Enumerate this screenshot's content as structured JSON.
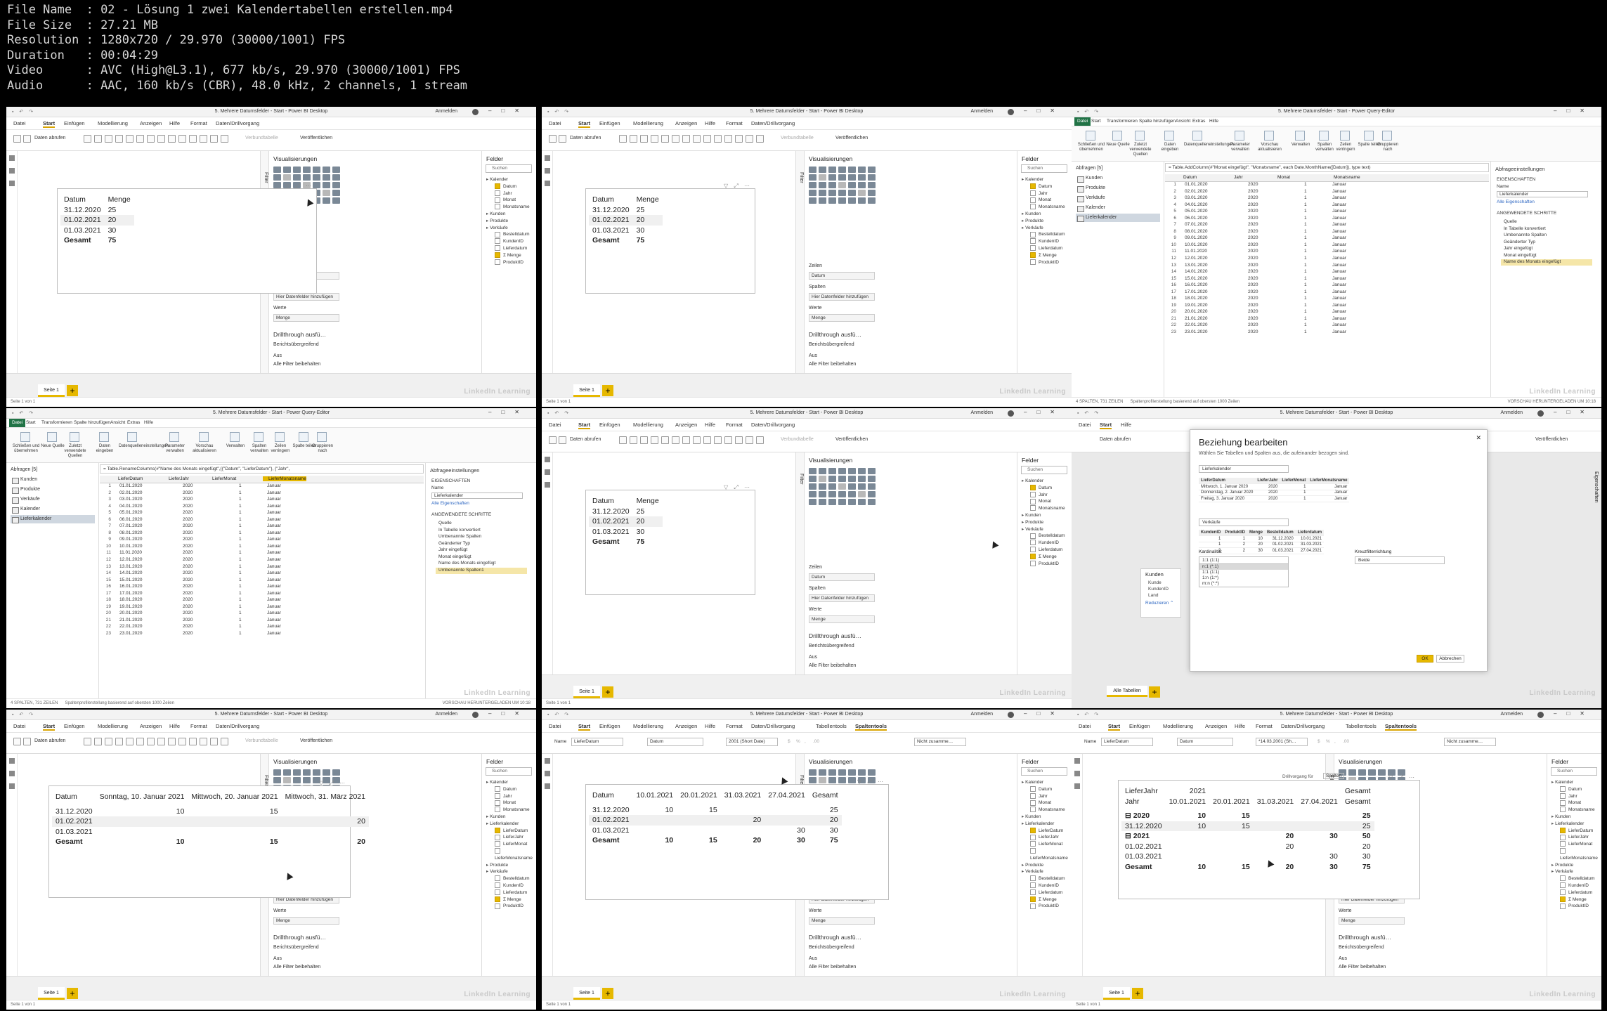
{
  "meta": {
    "file_name": "02 - Lösung 1 zwei Kalendertabellen erstellen.mp4",
    "file_size": "27.21 MB",
    "resolution": "1280x720 / 29.970 (30000/1001) FPS",
    "duration": "00:04:29",
    "video": "AVC (High@L3.1), 677 kb/s, 29.970 (30000/1001) FPS",
    "audio": "AAC, 160 kb/s (CBR), 48.0 kHz, 2 channels, 1 stream",
    "labels": {
      "file_name": "File Name  : ",
      "file_size": "File Size  : ",
      "resolution": "Resolution : ",
      "duration": "Duration   : ",
      "video": "Video      : ",
      "audio": "Audio      : "
    }
  },
  "pbi": {
    "title": "5. Mehrere Datumsfelder - Start - Power BI Desktop",
    "signin": "Anmelden",
    "menu": [
      "Datei",
      "Start",
      "Einfügen",
      "Modellierung",
      "Anzeigen",
      "Hilfe",
      "Format",
      "Daten/Drilldrilldrillvorgang"
    ],
    "menu_fix": [
      "Datei",
      "Start",
      "Einfügen",
      "Modellierung",
      "Anzeigen",
      "Hilfe",
      "Format",
      "Daten/Drillvorgang"
    ],
    "ribbon": {
      "get_data": "Daten abrufen",
      "refresh": "Veröffentlichen",
      "recent": "Verbundtabelle"
    },
    "filter": "Filter",
    "visualizations": "Visualisierungen",
    "fields": "Felder",
    "search": "Suchen",
    "rows_label": "Zeilen",
    "cols_label": "Spalten",
    "values_label": "Werte",
    "rows_val": "Datum",
    "rows_val2": "LieferDatum",
    "cols_placeholder": "Hier Datenfelder hinzufügen",
    "values_val": "Menge",
    "drillthrough": "Drillthrough ausfü…",
    "crossreport": "Berichtsübergreifend",
    "off": "Aus",
    "keepall": "Alle Filter beibehalten",
    "page_tab": "Seite 1",
    "page_status": "Seite 1 von 1",
    "watermark": "LinkedIn Learning",
    "fields_list_a": [
      {
        "t": "Kalender",
        "k": "grp"
      },
      {
        "t": "Datum",
        "k": "ck"
      },
      {
        "t": "Jahr",
        "k": "c"
      },
      {
        "t": "Monat",
        "k": "c"
      },
      {
        "t": "Monatsname",
        "k": "c"
      },
      {
        "t": "Kunden",
        "k": "grp"
      },
      {
        "t": "Produkte",
        "k": "grp"
      },
      {
        "t": "Verkäufe",
        "k": "grp"
      },
      {
        "t": "Bestelldatum",
        "k": "c"
      },
      {
        "t": "KundenID",
        "k": "c"
      },
      {
        "t": "Lieferdatum",
        "k": "c"
      },
      {
        "t": "Σ Menge",
        "k": "ck"
      },
      {
        "t": "ProduktID",
        "k": "c"
      }
    ],
    "fields_list_b": [
      {
        "t": "Kalender",
        "k": "grp"
      },
      {
        "t": "Datum",
        "k": "c"
      },
      {
        "t": "Jahr",
        "k": "c"
      },
      {
        "t": "Monat",
        "k": "c"
      },
      {
        "t": "Monatsname",
        "k": "c"
      },
      {
        "t": "Kunden",
        "k": "grp"
      },
      {
        "t": "Lieferkalender",
        "k": "grp"
      },
      {
        "t": "LieferDatum",
        "k": "ck"
      },
      {
        "t": "LieferJahr",
        "k": "c"
      },
      {
        "t": "LieferMonat",
        "k": "c"
      },
      {
        "t": "LieferMonatsname",
        "k": "c"
      },
      {
        "t": "Produkte",
        "k": "grp"
      },
      {
        "t": "Verkäufe",
        "k": "grp"
      },
      {
        "t": "Bestelldatum",
        "k": "c"
      },
      {
        "t": "KundenID",
        "k": "c"
      },
      {
        "t": "Lieferdatum",
        "k": "c"
      },
      {
        "t": "Σ Menge",
        "k": "ck"
      },
      {
        "t": "ProduktID",
        "k": "c"
      }
    ]
  },
  "matrix_a": {
    "h1": "Datum",
    "h2": "Menge",
    "rows": [
      [
        "31.12.2020",
        "25"
      ],
      [
        "01.02.2021",
        "20"
      ],
      [
        "01.03.2021",
        "30"
      ]
    ],
    "total": [
      "Gesamt",
      "75"
    ]
  },
  "matrix_c": {
    "headers": [
      "Datum",
      "Sonntag, 10. Januar 2021",
      "Mittwoch, 20. Januar 2021",
      "Mittwoch, 31. März 2021"
    ],
    "rows": [
      [
        "31.12.2020",
        "10",
        "15",
        ""
      ],
      [
        "01.02.2021",
        "",
        "",
        "20"
      ],
      [
        "01.03.2021",
        "",
        "",
        ""
      ]
    ],
    "total": [
      "Gesamt",
      "10",
      "15",
      "20"
    ]
  },
  "matrix_d": {
    "headers": [
      "Datum",
      "10.01.2021",
      "20.01.2021",
      "31.03.2021",
      "27.04.2021",
      "Gesamt"
    ],
    "rows": [
      [
        "31.12.2020",
        "10",
        "15",
        "",
        "",
        "25"
      ],
      [
        "01.02.2021",
        "",
        "",
        "20",
        "",
        "20"
      ],
      [
        "01.03.2021",
        "",
        "",
        "",
        "30",
        "30"
      ]
    ],
    "total": [
      "Gesamt",
      "10",
      "15",
      "20",
      "30",
      "75"
    ]
  },
  "matrix_e": {
    "h_row1": [
      "LieferJahr",
      "2021",
      "",
      "",
      "",
      "Gesamt"
    ],
    "h_row2": [
      "Jahr",
      "10.01.2021",
      "20.01.2021",
      "31.03.2021",
      "27.04.2021",
      "Gesamt"
    ],
    "rows": [
      [
        "⊟ 2020",
        "10",
        "15",
        "",
        "",
        "25"
      ],
      [
        "31.12.2020",
        "10",
        "15",
        "",
        "",
        "25"
      ],
      [
        "⊟ 2021",
        "",
        "",
        "20",
        "30",
        "50"
      ],
      [
        "01.02.2021",
        "",
        "",
        "20",
        "",
        "20"
      ],
      [
        "01.03.2021",
        "",
        "",
        "",
        "30",
        "30"
      ]
    ],
    "total": [
      "Gesamt",
      "10",
      "15",
      "20",
      "30",
      "75"
    ]
  },
  "column_tools": {
    "name_label": "Name",
    "name_val": "LieferDatum",
    "type_val": "Datum",
    "format_d": "2001 (Short Date)",
    "format_e": "*14.03.2001 (Sh…",
    "summarize": "Nicht zusamme…",
    "tab_table": "Tabellentools",
    "tab_column": "Spaltentools",
    "drillvorgang": "Drillvorgang für",
    "spalten": "Spalten"
  },
  "pq": {
    "title": "5. Mehrere Datumsfelder - Start - Power Query-Editor",
    "tabs": [
      "Datei",
      "Start",
      "Transformieren",
      "Spalte hinzufügen",
      "Ansicht",
      "Extras",
      "Hilfe"
    ],
    "queries_hdr": "Abfragen [5]",
    "queries": [
      "Kunden",
      "Produkte",
      "Verkäufe",
      "Kalender",
      "Lieferkalender"
    ],
    "formula_1": "= Table.AddColumn(#\"Monat eingefügt\", \"Monatsname\", each Date.MonthName([Datum]), type text)",
    "formula_2": "= Table.RenameColumns(#\"Name des Monats eingefügt\",{{\"Datum\", \"LieferDatum\"}, {\"Jahr\",",
    "cols_1": [
      "Datum",
      "Jahr",
      "Monat",
      "Monatsname"
    ],
    "cols_2": [
      "LieferDatum",
      "LieferJahr",
      "LieferMonat",
      "LieferMonatsname"
    ],
    "dates": [
      "01.01.2020",
      "02.01.2020",
      "03.01.2020",
      "04.01.2020",
      "05.01.2020",
      "06.01.2020",
      "07.01.2020",
      "08.01.2020",
      "09.01.2020",
      "10.01.2020",
      "11.01.2020",
      "12.01.2020",
      "13.01.2020",
      "14.01.2020",
      "15.01.2020",
      "16.01.2020",
      "17.01.2020",
      "18.01.2020",
      "19.01.2020",
      "20.01.2020",
      "21.01.2020",
      "22.01.2020",
      "23.01.2020"
    ],
    "year": "2020",
    "month": "1",
    "month_name": "Januar",
    "settings_hdr": "Abfrageeinstellungen",
    "props": "EIGENSCHAFTEN",
    "name_lbl": "Name",
    "name_val": "Lieferkalender",
    "allprops": "Alle Eigenschaften",
    "steps_hdr": "ANGEWENDETE SCHRITTE",
    "steps_1": [
      "Quelle",
      "In Tabelle konvertiert",
      "Umbenannte Spalten",
      "Geänderter Typ",
      "Jahr eingefügt",
      "Monat eingefügt",
      "Name des Monats eingefügt"
    ],
    "steps_2": [
      "Quelle",
      "In Tabelle konvertiert",
      "Umbenannte Spalten",
      "Geänderter Typ",
      "Jahr eingefügt",
      "Monat eingefügt",
      "Name des Monats eingefügt",
      "Umbenannte Spalten1"
    ],
    "status": "4 SPALTEN, 731 ZEILEN",
    "status2": "Spaltenprofilerstellung basierend auf obersten 1000 Zeilen",
    "preview": "VORSCHAU HERUNTERGELADEN UM 10:18",
    "ribbon_labels": [
      "Schließen und übernehmen",
      "Neue Quelle",
      "Zuletzt verwendete Quellen",
      "Daten eingeben",
      "Datenquelleneinstellungen",
      "Parameter verwalten",
      "Vorschau aktualisieren",
      "Verwalten",
      "Spalten verwalten",
      "Zeilen verringern",
      "Spalte teilen",
      "Gruppieren nach"
    ]
  },
  "dialog": {
    "title": "Beziehung bearbeiten",
    "subtitle": "Wählen Sie Tabellen und Spalten aus, die aufeinander bezogen sind.",
    "table1": "Lieferkalender",
    "t1_headers": [
      "LieferDatum",
      "LieferJahr",
      "LieferMonat",
      "LieferMonatsname"
    ],
    "t1_rows": [
      [
        "Mittwoch, 1. Januar 2020",
        "2020",
        "1",
        "Januar"
      ],
      [
        "Donnerstag, 2. Januar 2020",
        "2020",
        "1",
        "Januar"
      ],
      [
        "Freitag, 3. Januar 2020",
        "2020",
        "1",
        "Januar"
      ]
    ],
    "table2": "Verkäufe",
    "t2_headers": [
      "KundenID",
      "ProduktID",
      "Menge",
      "Bestelldatum",
      "Lieferdatum"
    ],
    "t2_rows": [
      [
        "1",
        "1",
        "10",
        "31.12.2020",
        "10.01.2021"
      ],
      [
        "1",
        "2",
        "20",
        "01.02.2021",
        "31.03.2021"
      ],
      [
        "2",
        "2",
        "30",
        "01.03.2021",
        "27.04.2021"
      ]
    ],
    "card_label": "Kardinalität",
    "card_val": "1:1 (1:1)",
    "card_opts": [
      "n:1 (*:1)",
      "1:1 (1:1)",
      "1:n (1:*)",
      "m:n (*:*)"
    ],
    "cross_label": "Kreuzfilterrichtung",
    "cross_val": "Beide",
    "ok": "OK",
    "cancel": "Abbrechen",
    "side_title": "Kunden",
    "side_fields": [
      "Kunde",
      "KundenID",
      "Land"
    ],
    "side_collapse": "Reduzieren ⌃",
    "all_tables": "Alle Tabellen",
    "properties": "Eigenschaften"
  }
}
